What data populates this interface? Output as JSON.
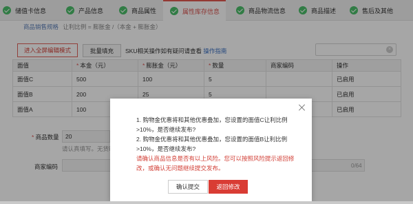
{
  "tabs": [
    {
      "label": "储值卡信息",
      "active": false
    },
    {
      "label": "产品信息",
      "active": false
    },
    {
      "label": "商品属性",
      "active": false
    },
    {
      "label": "属性库存信息",
      "active": true
    },
    {
      "label": "商品物流信息",
      "active": false
    },
    {
      "label": "商品描述",
      "active": false
    },
    {
      "label": "售后及其他",
      "active": false
    }
  ],
  "subhead": {
    "title": "商品销售规格",
    "formula": "让利比例 = 膨胀金 /（本金 + 膨胀金）"
  },
  "toolbar": {
    "fullscreen_label": "进入全屏编辑模式",
    "batch_label": "批量填充",
    "tip_text": "SKU相关操作如有疑问请查看",
    "tip_link": "操作指南"
  },
  "table": {
    "headers": [
      {
        "label": "面值",
        "required": false
      },
      {
        "label": "本金（元）",
        "required": true
      },
      {
        "label": "膨胀金（元）",
        "required": true
      },
      {
        "label": "数量",
        "required": true
      },
      {
        "label": "商家编码",
        "required": false
      },
      {
        "label": "操作",
        "required": false
      }
    ],
    "rows": [
      [
        "面值C",
        "500",
        "100",
        "5",
        "",
        "已启用"
      ],
      [
        "面值B",
        "200",
        "25",
        "5",
        "",
        "已启用"
      ],
      [
        "面值A",
        "100",
        "",
        "",
        "",
        "已启用"
      ]
    ]
  },
  "form": {
    "qty_label": "商品数量",
    "qty_value": "20",
    "qty_hint": "请认真填写。无货时",
    "code_label": "商家编码",
    "code_counter": "0/64"
  },
  "modal": {
    "line1": "1. 购物金优惠将和其他优惠叠加，您设置的面值C让利比例",
    "line2": ">10%，是否继续发布?",
    "line3": "2. 购物金优惠将和其他优惠叠加，您设置的面值B让利比例",
    "line4": ">10%，是否继续发布?",
    "warn1": "请确认商品信息是否有以上风险。您可以按照风险提示返回修",
    "warn2": "改，或确认无问题继续提交发布。",
    "confirm_label": "确认提交",
    "return_label": "返回修改"
  },
  "colors": {
    "accent": "#d93c34",
    "check": "#4cbf6a",
    "link": "#3a6fc1"
  }
}
